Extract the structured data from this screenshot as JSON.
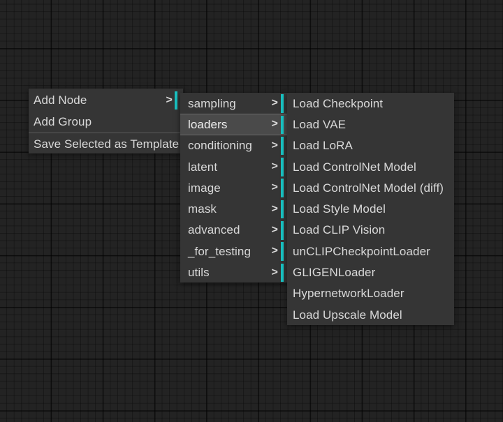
{
  "app": {
    "context_menu_title": "Add Node",
    "accent_color": "#19c3c3",
    "panel_bg": "#353535",
    "canvas_bg": "#232323",
    "text_color": "#d9d9d9",
    "highlight_bg": "#4a4a4a"
  },
  "menu_level1": {
    "items": [
      {
        "label": "Add Node",
        "has_submenu": true,
        "chevron": ">"
      },
      {
        "label": "Add Group",
        "has_submenu": false,
        "chevron": ""
      },
      {
        "label": "Save Selected as Template",
        "has_submenu": false,
        "chevron": ""
      }
    ],
    "separator_after_index": 1
  },
  "menu_level2": {
    "items": [
      {
        "label": "sampling",
        "has_submenu": true,
        "chevron": ">",
        "selected": false
      },
      {
        "label": "loaders",
        "has_submenu": true,
        "chevron": ">",
        "selected": true
      },
      {
        "label": "conditioning",
        "has_submenu": true,
        "chevron": ">",
        "selected": false
      },
      {
        "label": "latent",
        "has_submenu": true,
        "chevron": ">",
        "selected": false
      },
      {
        "label": "image",
        "has_submenu": true,
        "chevron": ">",
        "selected": false
      },
      {
        "label": "mask",
        "has_submenu": true,
        "chevron": ">",
        "selected": false
      },
      {
        "label": "advanced",
        "has_submenu": true,
        "chevron": ">",
        "selected": false
      },
      {
        "label": "_for_testing",
        "has_submenu": true,
        "chevron": ">",
        "selected": false
      },
      {
        "label": "utils",
        "has_submenu": true,
        "chevron": ">",
        "selected": false
      }
    ]
  },
  "menu_level3": {
    "items": [
      {
        "label": "Load Checkpoint"
      },
      {
        "label": "Load VAE"
      },
      {
        "label": "Load LoRA"
      },
      {
        "label": "Load ControlNet Model"
      },
      {
        "label": "Load ControlNet Model (diff)"
      },
      {
        "label": "Load Style Model"
      },
      {
        "label": "Load CLIP Vision"
      },
      {
        "label": "unCLIPCheckpointLoader"
      },
      {
        "label": "GLIGENLoader"
      },
      {
        "label": "HypernetworkLoader"
      },
      {
        "label": "Load Upscale Model"
      }
    ]
  }
}
